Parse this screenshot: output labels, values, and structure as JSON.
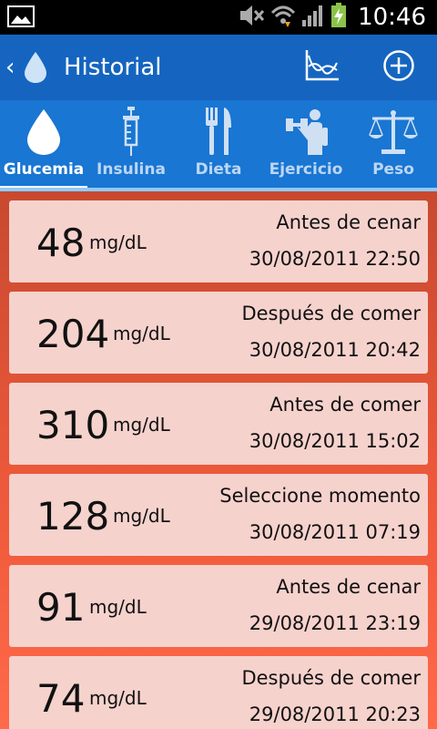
{
  "status_bar": {
    "time": "10:46",
    "icons": [
      "image-icon",
      "mute-icon",
      "wifi-icon",
      "signal-icon",
      "battery-charging-icon"
    ]
  },
  "action_bar": {
    "title": "Historial",
    "background": "#1565c0"
  },
  "tabs": [
    {
      "label": "Glucemia",
      "icon": "drop-icon",
      "active": true
    },
    {
      "label": "Insulina",
      "icon": "syringe-icon",
      "active": false
    },
    {
      "label": "Dieta",
      "icon": "fork-knife-icon",
      "active": false
    },
    {
      "label": "Ejercicio",
      "icon": "dumbbell-icon",
      "active": false
    },
    {
      "label": "Peso",
      "icon": "scale-icon",
      "active": false
    }
  ],
  "records": [
    {
      "value": "48",
      "unit": "mg/dL",
      "moment": "Antes de cenar",
      "datetime": "30/08/2011 22:50"
    },
    {
      "value": "204",
      "unit": "mg/dL",
      "moment": "Después de comer",
      "datetime": "30/08/2011 20:42"
    },
    {
      "value": "310",
      "unit": "mg/dL",
      "moment": "Antes de comer",
      "datetime": "30/08/2011 15:02"
    },
    {
      "value": "128",
      "unit": "mg/dL",
      "moment": "Seleccione momento",
      "datetime": "30/08/2011 07:19"
    },
    {
      "value": "91",
      "unit": "mg/dL",
      "moment": "Antes de cenar",
      "datetime": "29/08/2011 23:19"
    },
    {
      "value": "74",
      "unit": "mg/dL",
      "moment": "Después de comer",
      "datetime": "29/08/2011 20:23"
    }
  ],
  "colors": {
    "accent": "#1976d2",
    "card": "#f6d2cd",
    "list_top": "#c8492f",
    "list_bottom": "#ff6a4a"
  }
}
